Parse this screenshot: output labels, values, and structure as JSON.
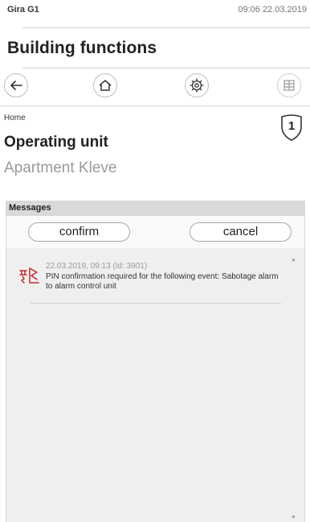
{
  "statusbar": {
    "device": "Gira G1",
    "datetime": "09:06 22.03.2019"
  },
  "app": {
    "title": "Building functions"
  },
  "nav": {
    "back_icon": "back-arrow-icon",
    "home_icon": "home-icon",
    "settings_icon": "gear-icon",
    "grid_icon": "grid-icon"
  },
  "page": {
    "breadcrumb": "Home",
    "title": "Operating unit",
    "subtitle": "Apartment Kleve",
    "badge": "1"
  },
  "messages": {
    "header": "Messages",
    "confirm_label": "confirm",
    "cancel_label": "cancel",
    "items": [
      {
        "meta": "22.03.2019, 09:13 (Id: 3901)",
        "text": "PIN confirmation required for the following event: Sabotage alarm to alarm control unit",
        "icon": "sabotage-alarm-icon"
      }
    ]
  },
  "colors": {
    "accent": "#c0282d",
    "header_bg": "#d9d9d9",
    "panel_bg": "#efefef"
  }
}
